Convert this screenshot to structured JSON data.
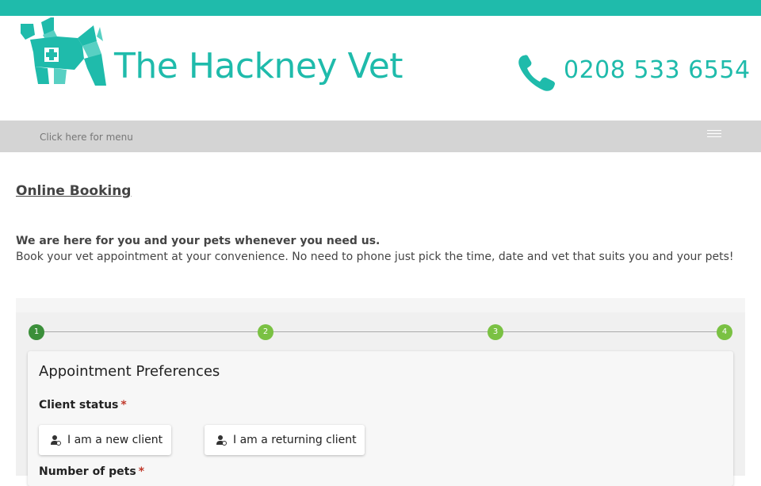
{
  "brand": {
    "name": "The Hackney Vet",
    "accent_color": "#1fbbab"
  },
  "contact": {
    "phone": "0208 533 6554"
  },
  "nav": {
    "menu_label": "Click here for menu"
  },
  "page": {
    "title": "Online Booking",
    "intro_bold": "We are here for you and your pets whenever you need us.",
    "intro_text": "Book your vet appointment at your convenience. No need to phone just pick the time, date and vet that suits you and your pets!"
  },
  "booking": {
    "steps": [
      "1",
      "2",
      "3",
      "4"
    ],
    "active_step": 1,
    "card_title": "Appointment Preferences",
    "client_status_label": "Client status",
    "required_mark": "*",
    "choices": [
      "I am a new client",
      "I am a returning client"
    ],
    "pets_label": "Number of pets"
  }
}
